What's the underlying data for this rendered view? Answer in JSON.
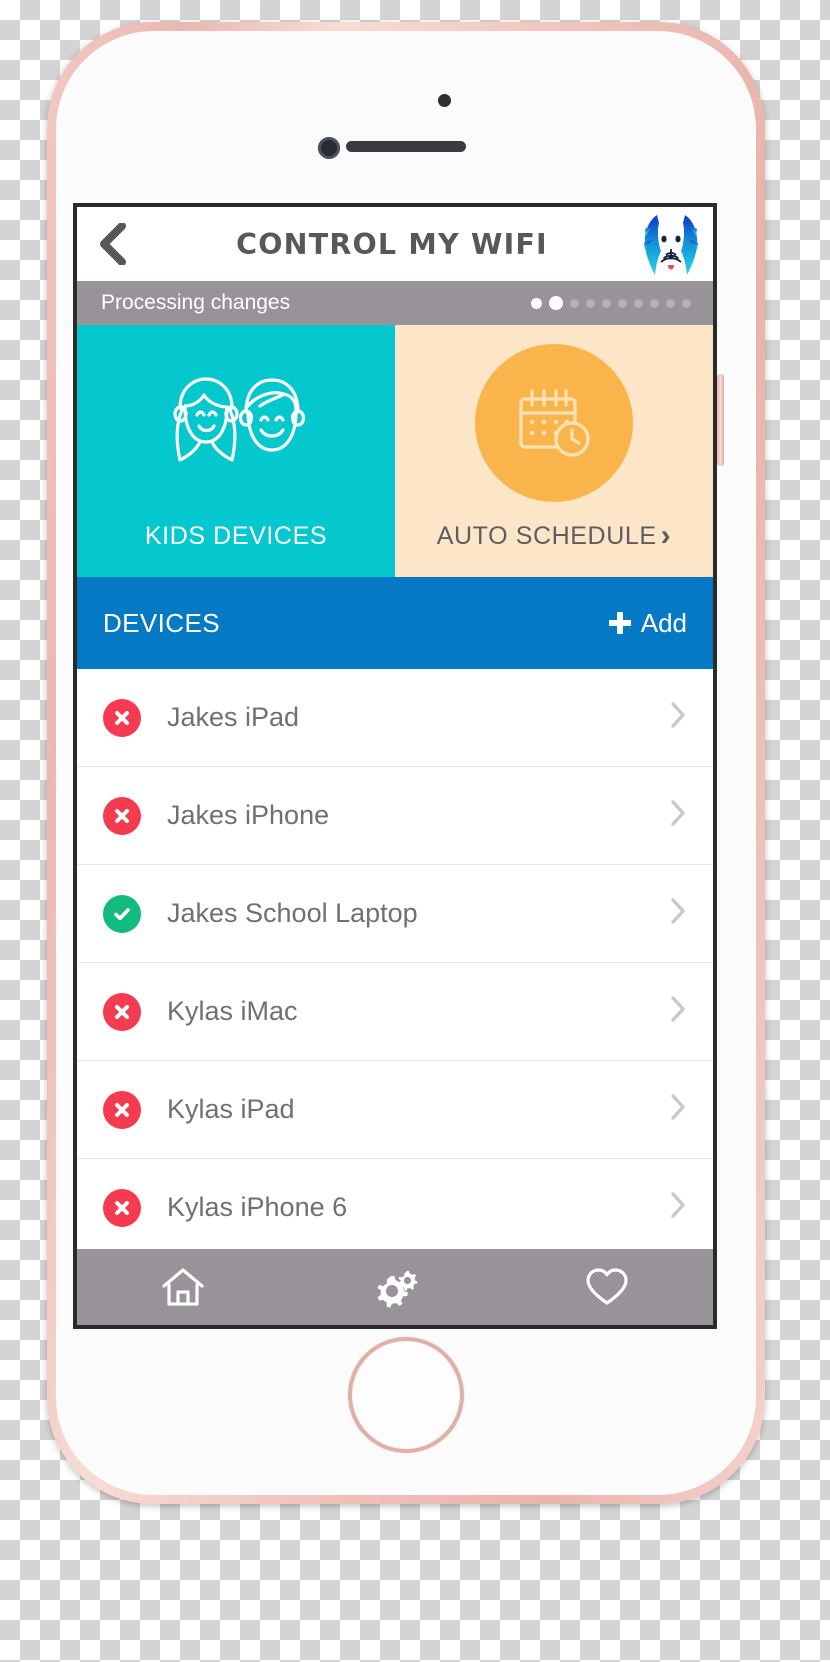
{
  "app": {
    "title": "CONTROL MY WIFI",
    "back_icon": "back-chevron-icon",
    "logo_icon": "dog-wifi-logo"
  },
  "status_strip": {
    "text": "Processing changes",
    "dots_total": 10,
    "dots_active": 2
  },
  "tiles": [
    {
      "key": "kids_devices",
      "label": "KIDS DEVICES",
      "icon": "two-kids-faces-icon",
      "bg_color": "#05C7CE",
      "text_color": "#FFFFFF",
      "has_chevron": false
    },
    {
      "key": "auto_schedule",
      "label": "AUTO SCHEDULE",
      "icon": "calendar-clock-icon",
      "bg_color": "#FCE6C7",
      "circle_color": "#F9B54C",
      "text_color": "#5D5D5F",
      "has_chevron": true,
      "chevron": "›"
    }
  ],
  "devices_section": {
    "title": "DEVICES",
    "add_label": "Add",
    "add_icon": "plus-icon",
    "bar_color": "#0579C4",
    "rows": [
      {
        "name": "Jakes iPad",
        "status": "blocked",
        "status_icon": "red-x-circle-icon",
        "chevron": "chevron-right-icon"
      },
      {
        "name": "Jakes iPhone",
        "status": "blocked",
        "status_icon": "red-x-circle-icon",
        "chevron": "chevron-right-icon"
      },
      {
        "name": "Jakes School Laptop",
        "status": "allowed",
        "status_icon": "green-check-circle-icon",
        "chevron": "chevron-right-icon"
      },
      {
        "name": "Kylas iMac",
        "status": "blocked",
        "status_icon": "red-x-circle-icon",
        "chevron": "chevron-right-icon"
      },
      {
        "name": "Kylas iPad",
        "status": "blocked",
        "status_icon": "red-x-circle-icon",
        "chevron": "chevron-right-icon"
      },
      {
        "name": "Kylas iPhone 6",
        "status": "blocked",
        "status_icon": "red-x-circle-icon",
        "chevron": "chevron-right-icon"
      }
    ]
  },
  "tab_bar": {
    "bg_color": "#989299",
    "items": [
      {
        "key": "home",
        "icon": "home-icon"
      },
      {
        "key": "settings",
        "icon": "gears-icon"
      },
      {
        "key": "favorites",
        "icon": "heart-icon"
      }
    ]
  },
  "colors": {
    "status_blocked": "#F53B50",
    "status_allowed": "#12BC7E",
    "accent_blue": "#0579C4",
    "accent_teal": "#05C7CE",
    "accent_orange": "#F9B54C",
    "strip_gray": "#989299"
  }
}
